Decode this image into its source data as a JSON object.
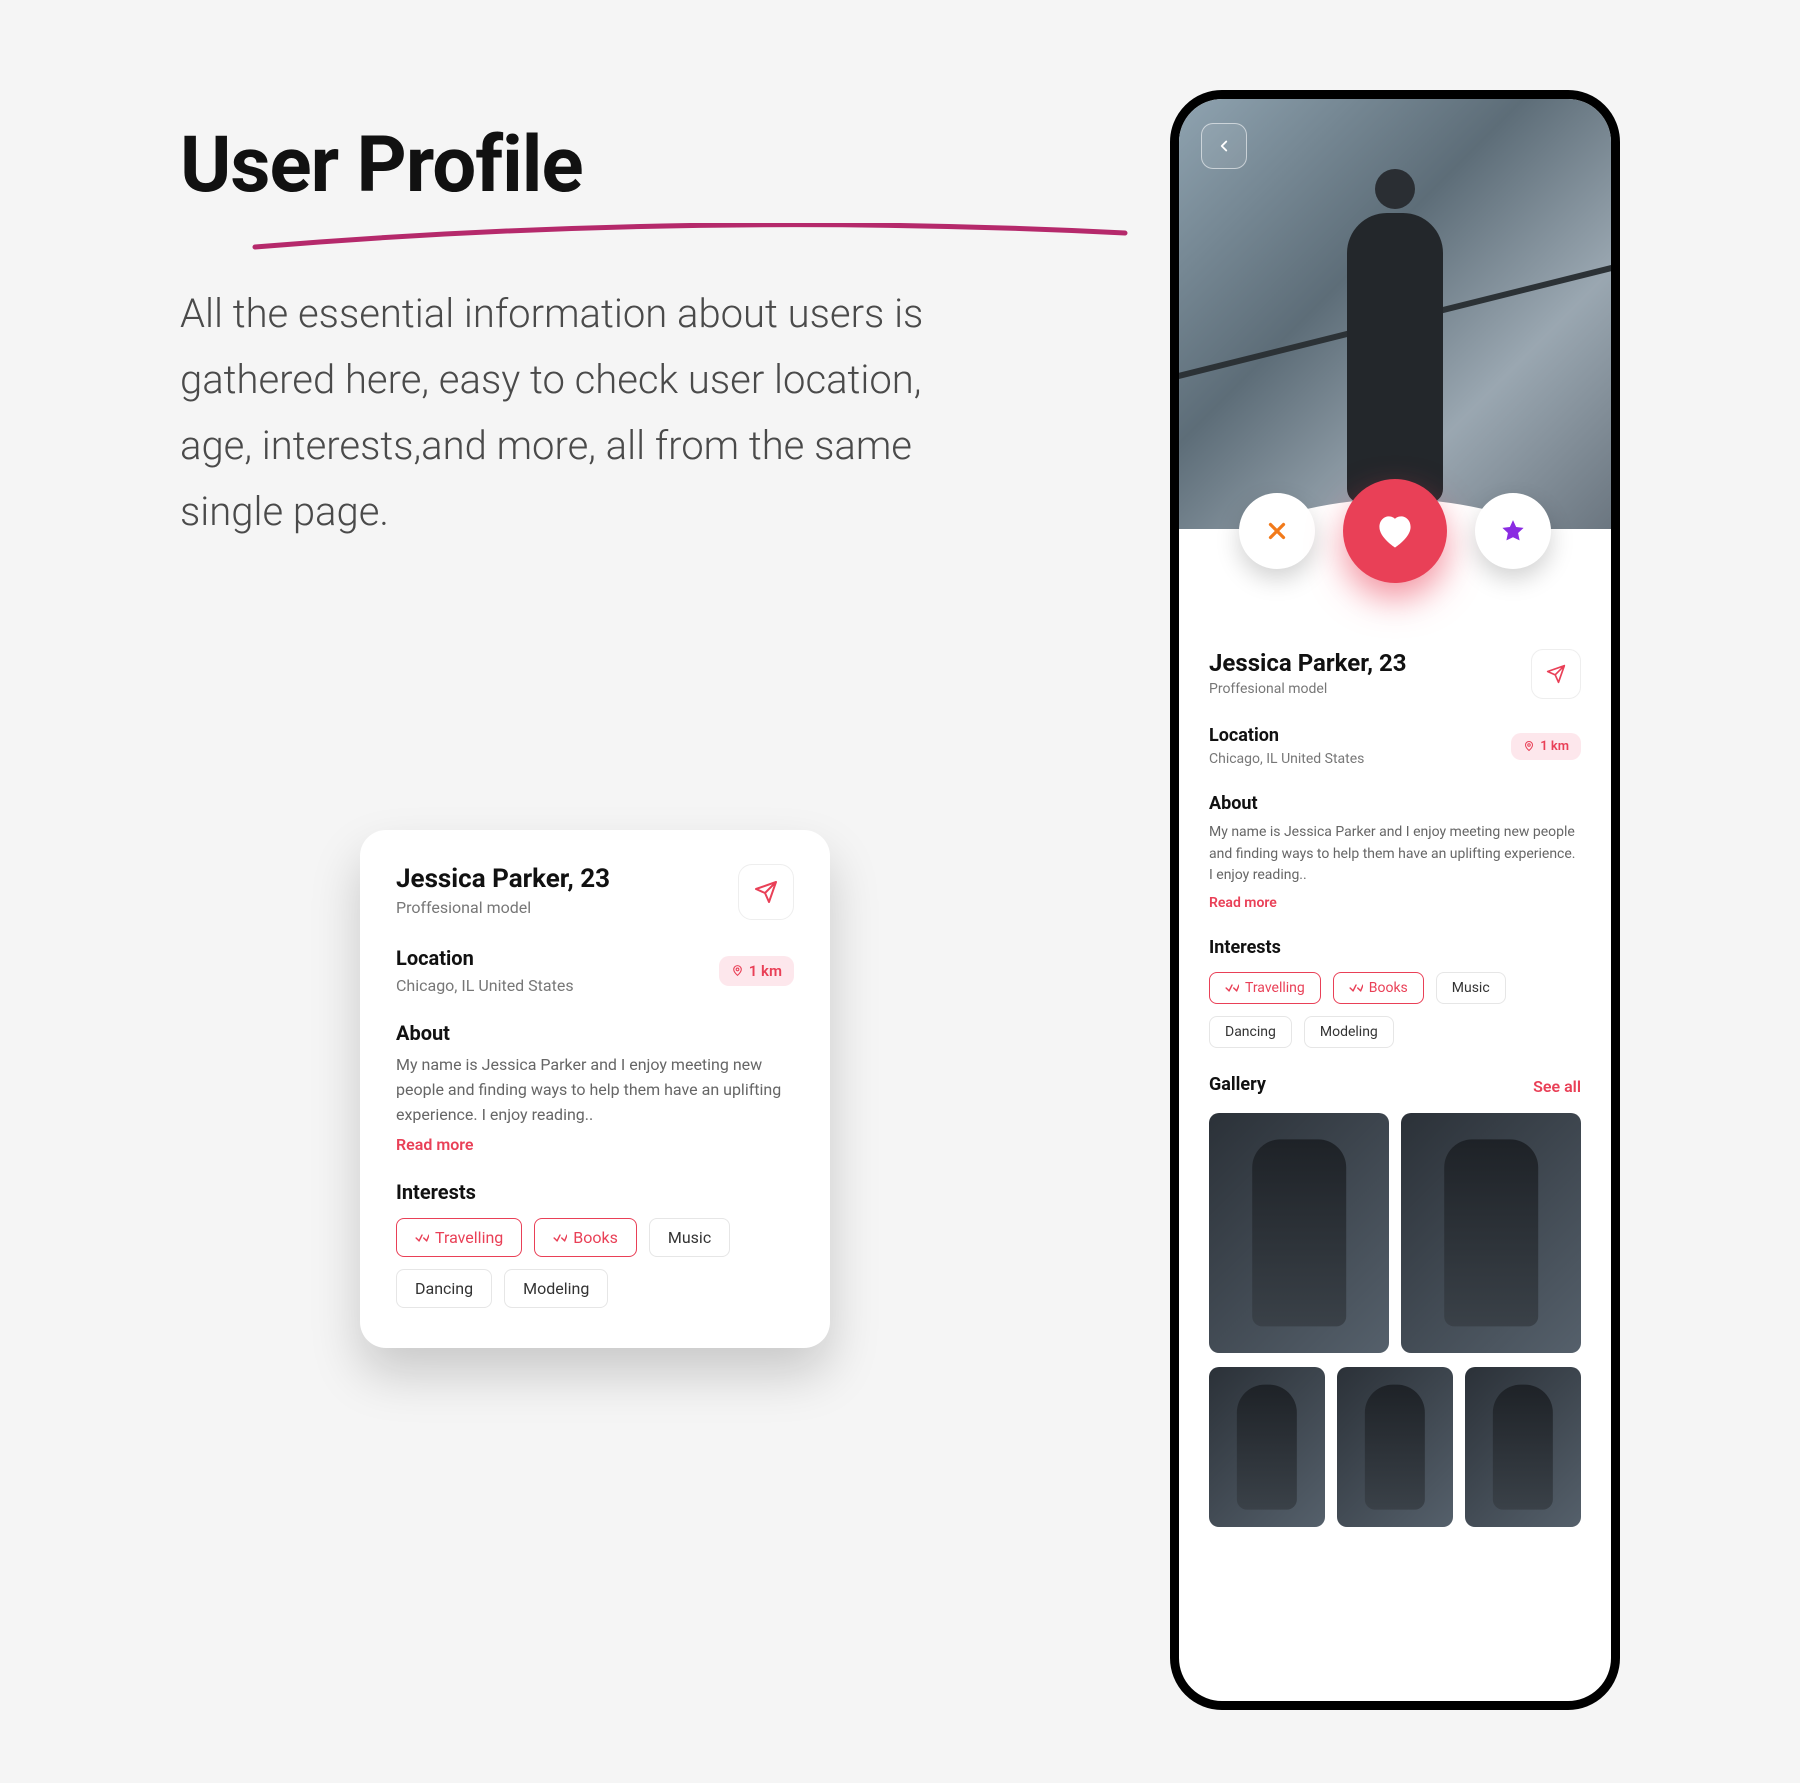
{
  "heading": "User Profile",
  "description": "All the essential information about users is gathered here, easy to check user location, age, interests,and more, all from the same single page.",
  "profile": {
    "name_age": "Jessica Parker, 23",
    "subtitle": "Proffesional model",
    "location_label": "Location",
    "location_value": "Chicago, IL United States",
    "distance": "1 km",
    "about_label": "About",
    "about_text": "My name is Jessica Parker and I enjoy meeting new people and finding ways to help them have an uplifting experience. I enjoy reading..",
    "read_more": "Read more",
    "interests_label": "Interests",
    "interests": [
      {
        "label": "Travelling",
        "selected": true
      },
      {
        "label": "Books",
        "selected": true
      },
      {
        "label": "Music",
        "selected": false
      },
      {
        "label": "Dancing",
        "selected": false
      },
      {
        "label": "Modeling",
        "selected": false
      }
    ],
    "gallery_label": "Gallery",
    "see_all": "See all"
  },
  "colors": {
    "accent": "#e94057",
    "star": "#8a2be2",
    "x": "#f27a1a"
  }
}
